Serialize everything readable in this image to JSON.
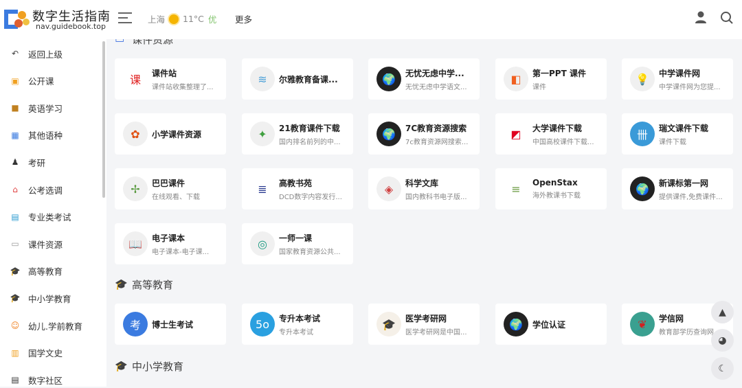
{
  "header": {
    "brand": "数字生活指南",
    "domain": "nav.guidebook.top",
    "city": "上海",
    "temp": "11°C",
    "air": "优",
    "more": "更多"
  },
  "sidebar": [
    {
      "label": "返回上级",
      "icon": "back-icon",
      "glyph": "↶",
      "color": "#444"
    },
    {
      "label": "公开课",
      "icon": "tv-icon",
      "glyph": "▣",
      "color": "#f0a020"
    },
    {
      "label": "英语学习",
      "icon": "book-icon",
      "glyph": "■",
      "color": "#c08020"
    },
    {
      "label": "其他语种",
      "icon": "calculator-icon",
      "glyph": "▦",
      "color": "#3b7be0"
    },
    {
      "label": "考研",
      "icon": "graduate-icon",
      "glyph": "♟",
      "color": "#333"
    },
    {
      "label": "公考选调",
      "icon": "house-icon",
      "glyph": "⌂",
      "color": "#e04040"
    },
    {
      "label": "专业类考试",
      "icon": "chart-icon",
      "glyph": "▤",
      "color": "#2a9ad0"
    },
    {
      "label": "课件资源",
      "icon": "document-icon",
      "glyph": "▭",
      "color": "#999"
    },
    {
      "label": "高等教育",
      "icon": "graduation-cap-icon",
      "glyph": "🎓",
      "color": "#3b6fe0"
    },
    {
      "label": "中小学教育",
      "icon": "graduation-cap-icon",
      "glyph": "🎓",
      "color": "#3b6fe0"
    },
    {
      "label": "幼儿.学前教育",
      "icon": "child-icon",
      "glyph": "☺",
      "color": "#f08020"
    },
    {
      "label": "国学文史",
      "icon": "books-icon",
      "glyph": "▥",
      "color": "#f0a020"
    },
    {
      "label": "数字社区",
      "icon": "community-icon",
      "glyph": "▤",
      "color": "#333"
    }
  ],
  "sections": [
    {
      "title": "课件资源",
      "cards": [
        {
          "name": "课件站",
          "desc": "课件站收集整理了...",
          "glyph": "课",
          "bg": "#fff",
          "fg": "#e02020"
        },
        {
          "name": "尔雅教育备课...",
          "desc": "",
          "glyph": "≋",
          "bg": "#f0f0f0",
          "fg": "#4aa0d8"
        },
        {
          "name": "无忧无虑中学...",
          "desc": "无忧无虑中学语文...",
          "glyph": "🌍",
          "bg": "#222",
          "fg": "#fff"
        },
        {
          "name": "第一PPT 课件",
          "desc": "课件",
          "glyph": "◧",
          "bg": "#f0f0f0",
          "fg": "#f06020"
        },
        {
          "name": "中学课件网",
          "desc": "中学课件网为您提...",
          "glyph": "💡",
          "bg": "#f0f0f0",
          "fg": "#e0b000"
        },
        {
          "name": "小学课件资源",
          "desc": "",
          "glyph": "✿",
          "bg": "#f0f0f0",
          "fg": "#e05010"
        },
        {
          "name": "21教育课件下载",
          "desc": "国内排名前列的中...",
          "glyph": "✦",
          "bg": "#f0f0f0",
          "fg": "#40a040"
        },
        {
          "name": "7C教育资源搜索",
          "desc": "7c教育资源网搜索...",
          "glyph": "🌍",
          "bg": "#222",
          "fg": "#fff"
        },
        {
          "name": "大学课件下载",
          "desc": "中国高校课件下载...",
          "glyph": "◩",
          "bg": "#fff",
          "fg": "#e00020"
        },
        {
          "name": "瑞文课件下载",
          "desc": "课件下载",
          "glyph": "卌",
          "bg": "#3a9ad8",
          "fg": "#fff"
        },
        {
          "name": "巴巴课件",
          "desc": "在线观看、下载",
          "glyph": "✢",
          "bg": "#f0f0f0",
          "fg": "#5a9a40"
        },
        {
          "name": "高教书苑",
          "desc": "DCD数字内容发行...",
          "glyph": "≣",
          "bg": "#fff",
          "fg": "#2a3a90"
        },
        {
          "name": "科学文库",
          "desc": "国内教科书电子版...",
          "glyph": "◈",
          "bg": "#f0f0f0",
          "fg": "#d04040"
        },
        {
          "name": "OpenStax",
          "desc": "海外教课书下载",
          "glyph": "≡",
          "bg": "#fff",
          "fg": "#6a9a40"
        },
        {
          "name": "新课标第一网",
          "desc": "提供课件,免费课件...",
          "glyph": "🌍",
          "bg": "#222",
          "fg": "#fff"
        },
        {
          "name": "电子课本",
          "desc": "电子课本-电子课...",
          "glyph": "📖",
          "bg": "#f0f0f0",
          "fg": "#5a9a40"
        },
        {
          "name": "一师一课",
          "desc": "国家教育资源公共...",
          "glyph": "◎",
          "bg": "#f0f0f0",
          "fg": "#1a9a80"
        }
      ]
    },
    {
      "title": "高等教育",
      "cards": [
        {
          "name": "博士生考试",
          "desc": "",
          "glyph": "考",
          "bg": "#3b7be0",
          "fg": "#fff"
        },
        {
          "name": "专升本考试",
          "desc": "专升本考试",
          "glyph": "5o",
          "bg": "#2aa0e0",
          "fg": "#fff"
        },
        {
          "name": "医学考研网",
          "desc": "医学考研网是中国...",
          "glyph": "🎓",
          "bg": "#f5f0e8",
          "fg": "#222"
        },
        {
          "name": "学位认证",
          "desc": "",
          "glyph": "🌍",
          "bg": "#222",
          "fg": "#fff"
        },
        {
          "name": "学信网",
          "desc": "教育部学历查询网...",
          "glyph": "❦",
          "bg": "#3aa090",
          "fg": "#d02020"
        }
      ]
    },
    {
      "title": "中小学教育",
      "cards": []
    }
  ]
}
